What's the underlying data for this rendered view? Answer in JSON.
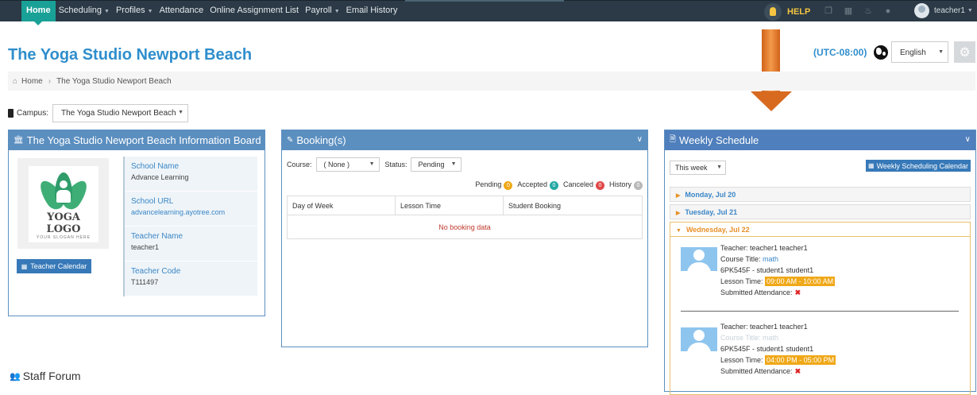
{
  "nav": {
    "items": [
      {
        "label": "Home",
        "active": true,
        "dropdown": false
      },
      {
        "label": "Scheduling",
        "active": false,
        "dropdown": true
      },
      {
        "label": "Profiles",
        "active": false,
        "dropdown": true
      },
      {
        "label": "Attendance",
        "active": false,
        "dropdown": false
      },
      {
        "label": "Online Assignment List",
        "active": false,
        "dropdown": false
      },
      {
        "label": "Payroll",
        "active": false,
        "dropdown": true
      },
      {
        "label": "Email History",
        "active": false,
        "dropdown": false
      }
    ],
    "help_label": "HELP",
    "user_name": "teacher1",
    "icons": [
      "copy-icon",
      "calendar-icon",
      "bell-icon",
      "chat-icon"
    ]
  },
  "page": {
    "title": "The Yoga Studio Newport Beach",
    "timezone": "(UTC-08:00)",
    "language": "English"
  },
  "breadcrumb": {
    "home": "Home",
    "current": "The Yoga Studio Newport Beach"
  },
  "campus": {
    "label": "Campus:",
    "value": "The Yoga Studio Newport Beach"
  },
  "info_board": {
    "title": "The Yoga Studio Newport Beach Information Board",
    "logo_text": "YOGA LOGO",
    "logo_slogan": "YOUR SLOGAN HERE",
    "teacher_calendar_button": "Teacher Calendar",
    "fields": [
      {
        "label": "School Name",
        "value": "Advance Learning",
        "link": false
      },
      {
        "label": "School URL",
        "value": "advancelearning.ayotree.com",
        "link": true
      },
      {
        "label": "Teacher Name",
        "value": "teacher1",
        "link": false
      },
      {
        "label": "Teacher Code",
        "value": "T111497",
        "link": false
      }
    ]
  },
  "bookings": {
    "title": "Booking(s)",
    "course_label": "Course:",
    "course_value": "( None )",
    "status_label": "Status:",
    "status_value": "Pending",
    "statuses": [
      {
        "label": "Pending",
        "count": "0",
        "color": "#f0a818"
      },
      {
        "label": "Accepted",
        "count": "0",
        "color": "#25a9a4"
      },
      {
        "label": "Canceled",
        "count": "0",
        "color": "#e04848"
      },
      {
        "label": "History",
        "count": "0",
        "color": "#b8b8b8"
      }
    ],
    "columns": [
      "Day of Week",
      "Lesson Time",
      "Student Booking"
    ],
    "empty_text": "No booking data"
  },
  "weekly": {
    "title": "Weekly Schedule",
    "week_select": "This week",
    "calendar_button": "Weekly Scheduling Calendar",
    "days": [
      {
        "label": "Monday, Jul 20",
        "open": false
      },
      {
        "label": "Tuesday, Jul 21",
        "open": false
      },
      {
        "label": "Wednesday, Jul 22",
        "open": true
      }
    ],
    "lessons": [
      {
        "teacher": "Teacher: teacher1 teacher1",
        "course_label": "Course Title:",
        "course": "math",
        "student": "6PK545F - student1 student1",
        "time_label": "Lesson Time:",
        "time": "09:00 AM - 10:00 AM",
        "attendance_label": "Submitted Attendance:",
        "faded": false
      },
      {
        "teacher": "Teacher: teacher1 teacher1",
        "course_label": "Course Title:",
        "course": "math",
        "student": "6PK545F - student1 student1",
        "time_label": "Lesson Time:",
        "time": "04:00 PM - 05:00 PM",
        "attendance_label": "Submitted Attendance:",
        "faded": true
      }
    ]
  },
  "staff_forum": {
    "title": "Staff Forum"
  },
  "colors": {
    "nav_bg": "#2b3a46",
    "nav_active": "#1aa197",
    "panel_header": "#5b8fc0",
    "title_blue": "#2f8ecc",
    "arrow": "#e07a2a"
  }
}
